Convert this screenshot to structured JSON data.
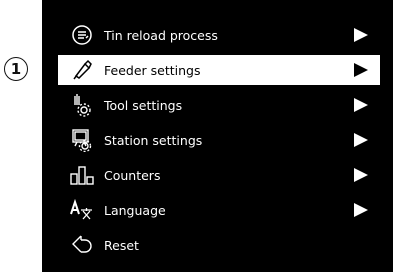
{
  "callout": {
    "number": "1"
  },
  "menu": {
    "items": [
      {
        "label": "Tin reload process",
        "icon": "tin-reload-icon",
        "has_submenu": true,
        "selected": false
      },
      {
        "label": "Feeder settings",
        "icon": "feeder-icon",
        "has_submenu": true,
        "selected": true
      },
      {
        "label": "Tool settings",
        "icon": "tool-settings-icon",
        "has_submenu": true,
        "selected": false
      },
      {
        "label": "Station settings",
        "icon": "station-settings-icon",
        "has_submenu": true,
        "selected": false
      },
      {
        "label": "Counters",
        "icon": "counters-icon",
        "has_submenu": true,
        "selected": false
      },
      {
        "label": "Language",
        "icon": "language-icon",
        "has_submenu": true,
        "selected": false
      },
      {
        "label": "Reset",
        "icon": "reset-icon",
        "has_submenu": false,
        "selected": false
      }
    ]
  },
  "colors": {
    "screen_bg": "#000000",
    "text": "#ffffff",
    "selected_bg": "#ffffff",
    "selected_text": "#000000"
  }
}
